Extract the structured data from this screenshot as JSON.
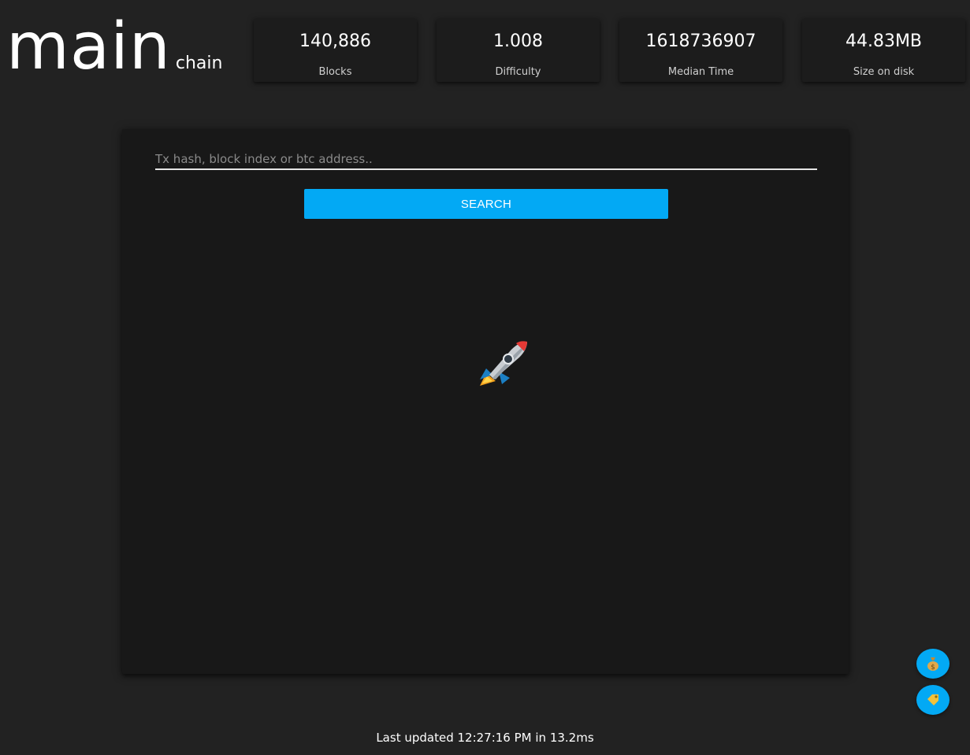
{
  "logo": {
    "main": "main",
    "sub": "chain"
  },
  "stats": [
    {
      "value": "140,886",
      "label": "Blocks"
    },
    {
      "value": "1.008",
      "label": "Difficulty"
    },
    {
      "value": "1618736907",
      "label": "Median Time"
    },
    {
      "value": "44.83MB",
      "label": "Size on disk"
    }
  ],
  "search": {
    "placeholder": "Tx hash, block index or btc address..",
    "value": "",
    "button_label": "SEARCH"
  },
  "illustration": {
    "icon": "rocket-icon"
  },
  "fabs": [
    {
      "icon": "money-bag-icon"
    },
    {
      "icon": "tag-icon"
    }
  ],
  "footer": {
    "text": "Last updated 12:27:16 PM in 13.2ms"
  },
  "colors": {
    "background": "#222222",
    "card": "#1c1c1c",
    "panel": "#181818",
    "accent": "#03a9f4"
  }
}
